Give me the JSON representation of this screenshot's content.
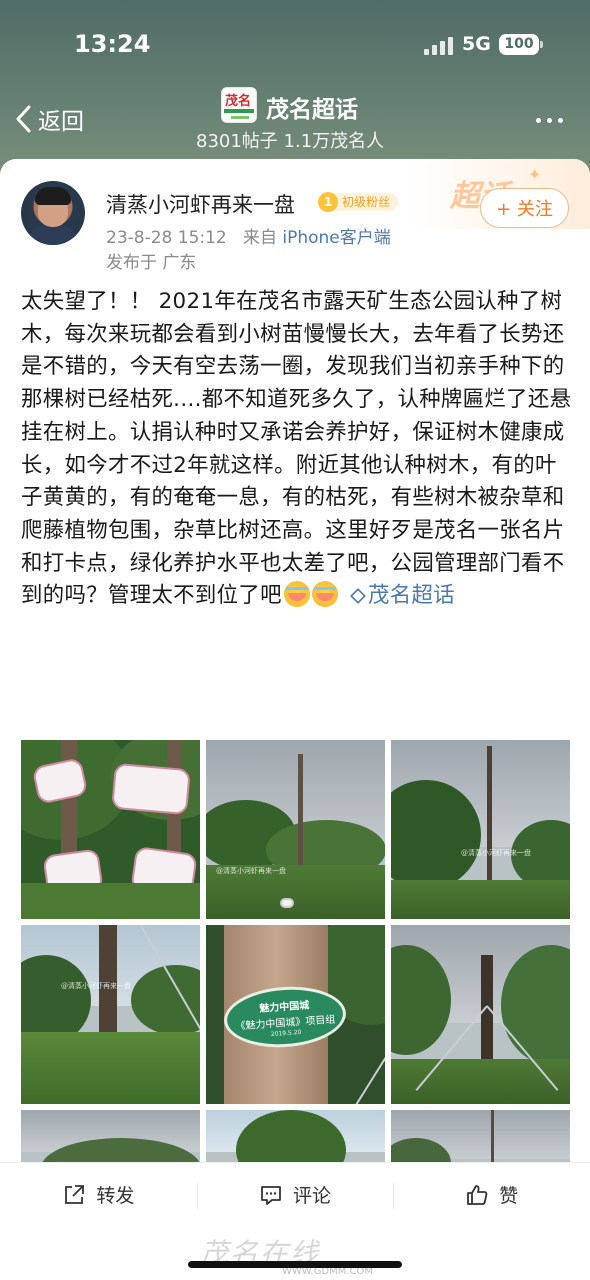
{
  "status_bar": {
    "time": "13:24",
    "network": "5G",
    "battery": "100"
  },
  "nav": {
    "back_label": "返回",
    "topic_title": "茂名超话",
    "topic_stats": "8301帖子 1.1万茂名人",
    "logo_text": "茂名"
  },
  "post": {
    "username": "清蒸小河虾再来一盘",
    "level": "1",
    "level_label": "初级粉丝",
    "follow_label": "+ 关注",
    "date": "23-8-28 15:12",
    "from_prefix": "来自",
    "source": "iPhone客户端",
    "location": "发布于 广东",
    "supertopic_mark": "超话",
    "body": "太失望了！！ 2021年在茂名市露天矿生态公园认种了树木，每次来玩都会看到小树苗慢慢长大，去年看了长势还是不错的，今天有空去荡一圈，发现我们当初亲手种下的那棵树已经枯死....都不知道死多久了，认种牌匾烂了还悬挂在树上。认捐认种时又承诺会养护好，保证树木健康成长，如今才不过2年就这样。附近其他认种树木，有的叶子黄黄的，有的奄奄一息，有的枯死，有些树木被杂草和爬藤植物包围，杂草比树还高。这里好歹是茂名一张名片和打卡点，绿化养护水平也太差了吧，公园管理部门看不到的吗？管理太不到位了吧",
    "topic_link": "茂名超话",
    "photo_watermark": "@清蒸小河虾再来一盘",
    "sign_text_1": "魅力中国城",
    "sign_text_2": "《魅力中国城》项目组",
    "sign_date": "2019.5.20"
  },
  "actions": {
    "repost": "转发",
    "comment": "评论",
    "like": "赞"
  },
  "watermark": {
    "brand": "茂名在线",
    "url": "WWW.GDMM.COM"
  }
}
